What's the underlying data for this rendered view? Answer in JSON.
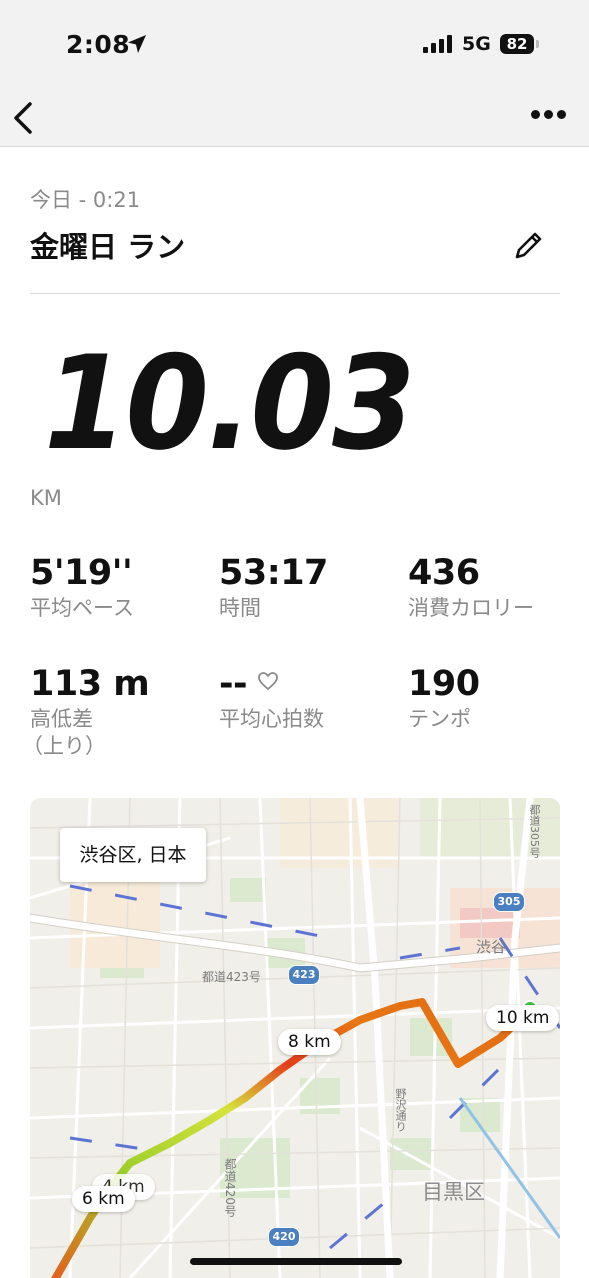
{
  "status_bar": {
    "time": "2:08",
    "network": "5G",
    "battery": "82"
  },
  "header": {
    "date_label": "今日 - 0:21",
    "title": "金曜日 ラン"
  },
  "distance": {
    "value": "10.03",
    "unit": "KM"
  },
  "stats": [
    {
      "value": "5'19''",
      "label": "平均ペース"
    },
    {
      "value": "53:17",
      "label": "時間"
    },
    {
      "value": "436",
      "label": "消費カロリー"
    },
    {
      "value": "113 m",
      "label": "高低差",
      "label_sub": "（上り）"
    },
    {
      "value": "--",
      "label": "平均心拍数"
    },
    {
      "value": "190",
      "label": "テンポ"
    }
  ],
  "map": {
    "area_label": "渋谷区, 日本",
    "km_markers": [
      "10 km",
      "8 km",
      "6 km",
      "4 km"
    ],
    "place_labels": {
      "shibuya": "渋谷",
      "meguro": "目黒区",
      "road_423": "都道423号",
      "road_420": "都道420号",
      "road_305": "都道305号",
      "nozawa": "野沢通り"
    },
    "route_badges": [
      "305",
      "423",
      "420"
    ]
  },
  "colors": {
    "accent_text": "#111111",
    "muted_text": "#8a8a8a",
    "route_start": "#e8581c",
    "route_mid": "#c8e03a",
    "route_end": "#e06a12"
  }
}
